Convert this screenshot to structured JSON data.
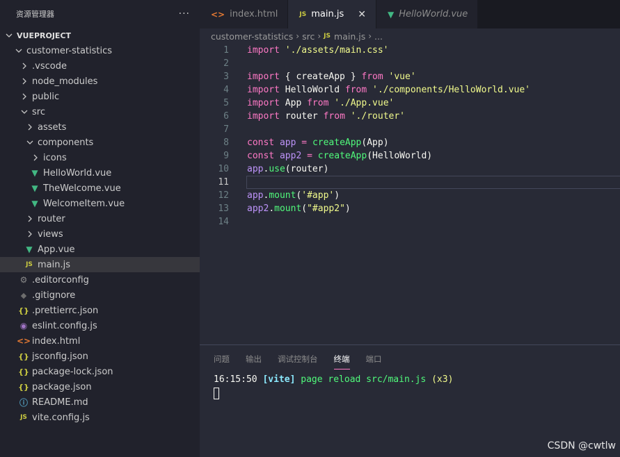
{
  "sidebar": {
    "title": "资源管理器",
    "more": "···",
    "root": "VUEPROJECT",
    "items": [
      {
        "label": "customer-statistics",
        "indent": 1,
        "kind": "folder",
        "open": true,
        "icon": "chevron-down-icon"
      },
      {
        "label": ".vscode",
        "indent": 2,
        "kind": "folder",
        "open": false,
        "icon": "chevron-right-icon"
      },
      {
        "label": "node_modules",
        "indent": 2,
        "kind": "folder",
        "open": false,
        "icon": "chevron-right-icon"
      },
      {
        "label": "public",
        "indent": 2,
        "kind": "folder",
        "open": false,
        "icon": "chevron-right-icon"
      },
      {
        "label": "src",
        "indent": 2,
        "kind": "folder",
        "open": true,
        "icon": "chevron-down-icon"
      },
      {
        "label": "assets",
        "indent": 3,
        "kind": "folder",
        "open": false,
        "icon": "chevron-right-icon"
      },
      {
        "label": "components",
        "indent": 3,
        "kind": "folder",
        "open": true,
        "icon": "chevron-down-icon"
      },
      {
        "label": "icons",
        "indent": 4,
        "kind": "folder",
        "open": false,
        "icon": "chevron-right-icon"
      },
      {
        "label": "HelloWorld.vue",
        "indent": 4,
        "kind": "vue",
        "icon": "vue-icon"
      },
      {
        "label": "TheWelcome.vue",
        "indent": 4,
        "kind": "vue",
        "icon": "vue-icon"
      },
      {
        "label": "WelcomeItem.vue",
        "indent": 4,
        "kind": "vue",
        "icon": "vue-icon"
      },
      {
        "label": "router",
        "indent": 3,
        "kind": "folder",
        "open": false,
        "icon": "chevron-right-icon"
      },
      {
        "label": "views",
        "indent": 3,
        "kind": "folder",
        "open": false,
        "icon": "chevron-right-icon"
      },
      {
        "label": "App.vue",
        "indent": 3,
        "kind": "vue",
        "icon": "vue-icon"
      },
      {
        "label": "main.js",
        "indent": 3,
        "kind": "js",
        "icon": "javascript-icon",
        "selected": true
      },
      {
        "label": ".editorconfig",
        "indent": 2,
        "kind": "gear",
        "icon": "gear-icon"
      },
      {
        "label": ".gitignore",
        "indent": 2,
        "kind": "git",
        "icon": "git-icon"
      },
      {
        "label": ".prettierrc.json",
        "indent": 2,
        "kind": "json",
        "icon": "json-icon"
      },
      {
        "label": "eslint.config.js",
        "indent": 2,
        "kind": "eslint",
        "icon": "eslint-icon"
      },
      {
        "label": "index.html",
        "indent": 2,
        "kind": "html",
        "icon": "html-icon"
      },
      {
        "label": "jsconfig.json",
        "indent": 2,
        "kind": "json",
        "icon": "json-icon"
      },
      {
        "label": "package-lock.json",
        "indent": 2,
        "kind": "json",
        "icon": "json-icon"
      },
      {
        "label": "package.json",
        "indent": 2,
        "kind": "json",
        "icon": "json-icon"
      },
      {
        "label": "README.md",
        "indent": 2,
        "kind": "info",
        "icon": "info-icon"
      },
      {
        "label": "vite.config.js",
        "indent": 2,
        "kind": "js",
        "icon": "javascript-icon"
      }
    ]
  },
  "tabs": [
    {
      "label": "index.html",
      "kind": "html",
      "active": false,
      "italic": false
    },
    {
      "label": "main.js",
      "kind": "js",
      "active": true,
      "italic": false,
      "close": "✕"
    },
    {
      "label": "HelloWorld.vue",
      "kind": "vue",
      "active": false,
      "italic": true
    }
  ],
  "breadcrumb": [
    "customer-statistics",
    "src",
    "main.js",
    "..."
  ],
  "code": {
    "current_line": 11,
    "lines": [
      [
        [
          "kw",
          "import"
        ],
        [
          "pl",
          " "
        ],
        [
          "str",
          "'./assets/main.css'"
        ]
      ],
      [],
      [
        [
          "kw",
          "import"
        ],
        [
          "pl",
          " { createApp } "
        ],
        [
          "kw",
          "from"
        ],
        [
          "pl",
          " "
        ],
        [
          "str",
          "'vue'"
        ]
      ],
      [
        [
          "kw",
          "import"
        ],
        [
          "pl",
          " HelloWorld "
        ],
        [
          "kw",
          "from"
        ],
        [
          "pl",
          " "
        ],
        [
          "str",
          "'./components/HelloWorld.vue'"
        ]
      ],
      [
        [
          "kw",
          "import"
        ],
        [
          "pl",
          " App "
        ],
        [
          "kw",
          "from"
        ],
        [
          "pl",
          " "
        ],
        [
          "str",
          "'./App.vue'"
        ]
      ],
      [
        [
          "kw",
          "import"
        ],
        [
          "pl",
          " router "
        ],
        [
          "kw",
          "from"
        ],
        [
          "pl",
          " "
        ],
        [
          "str",
          "'./router'"
        ]
      ],
      [],
      [
        [
          "kw",
          "const"
        ],
        [
          "pl",
          " "
        ],
        [
          "var",
          "app"
        ],
        [
          "pl",
          " "
        ],
        [
          "kw",
          "="
        ],
        [
          "pl",
          " "
        ],
        [
          "fn",
          "createApp"
        ],
        [
          "pl",
          "(App)"
        ]
      ],
      [
        [
          "kw",
          "const"
        ],
        [
          "pl",
          " "
        ],
        [
          "var",
          "app2"
        ],
        [
          "pl",
          " "
        ],
        [
          "kw",
          "="
        ],
        [
          "pl",
          " "
        ],
        [
          "fn",
          "createApp"
        ],
        [
          "pl",
          "(HelloWorld)"
        ]
      ],
      [
        [
          "var",
          "app"
        ],
        [
          "pl",
          "."
        ],
        [
          "fn",
          "use"
        ],
        [
          "pl",
          "(router)"
        ]
      ],
      [],
      [
        [
          "var",
          "app"
        ],
        [
          "pl",
          "."
        ],
        [
          "fn",
          "mount"
        ],
        [
          "pl",
          "("
        ],
        [
          "str",
          "'#app'"
        ],
        [
          "pl",
          ")"
        ]
      ],
      [
        [
          "var",
          "app2"
        ],
        [
          "pl",
          "."
        ],
        [
          "fn",
          "mount"
        ],
        [
          "pl",
          "("
        ],
        [
          "str",
          "\"#app2\""
        ],
        [
          "pl",
          ")"
        ]
      ],
      []
    ]
  },
  "panel": {
    "tabs": [
      "问题",
      "输出",
      "调试控制台",
      "终端",
      "端口"
    ],
    "active_tab": "终端",
    "terminal": {
      "time": "16:15:50",
      "tag": "[vite]",
      "message": "page reload src/main.js",
      "count": "(x3)"
    }
  },
  "watermark": "CSDN @cwtlw"
}
